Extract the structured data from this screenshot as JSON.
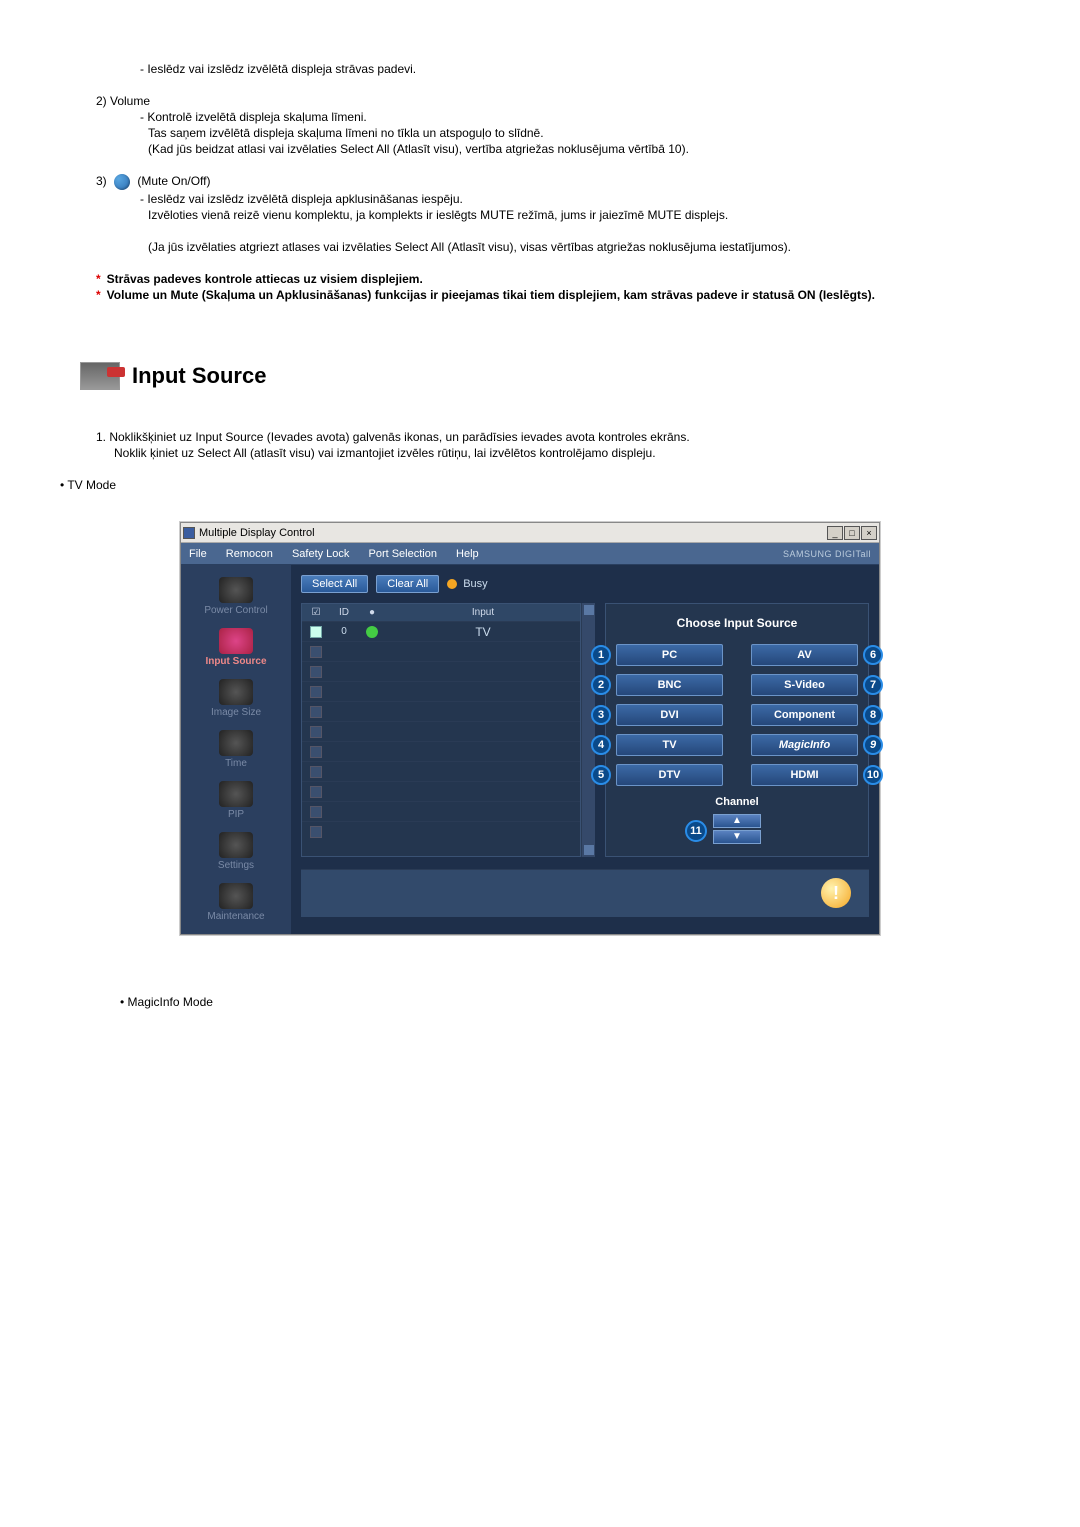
{
  "doc": {
    "item1_desc": "- Ieslēdz vai izslēdz izvēlētā displeja strāvas padevi.",
    "item2_title": "2)  Volume",
    "item2_line1": "- Kontrolē izvelētā displeja skaļuma līmeni.",
    "item2_line2": "Tas saņem izvēlētā displeja skaļuma līmeni no tīkla un atspoguļo to slīdnē.",
    "item2_line3": "(Kad jūs beidzat atlasi vai izvēlaties Select All (Atlasīt visu), vertība atgriežas noklusējuma vērtībā 10).",
    "item3_prefix": "3)",
    "item3_suffix": "(Mute On/Off)",
    "item3_line1": "- Ieslēdz vai izslēdz izvēlētā displeja apklusināšanas iespēju.",
    "item3_line2": "Izvēloties vienā reizē vienu komplektu, ja komplekts ir ieslēgts MUTE režīmā, jums ir jaiezīmē MUTE displejs.",
    "item3_line3": "(Ja jūs izvēlaties atgriezt atlases vai izvēlaties Select All (Atlasīt visu), visas vērtības atgriežas noklusējuma iestatījumos).",
    "note1": "Strāvas padeves kontrole attiecas uz visiem displejiem.",
    "note2": "Volume un Mute (Skaļuma un Apklusināšanas) funkcijas ir pieejamas tikai tiem displejiem, kam strāvas padeve ir statusā ON (Ieslēgts).",
    "section_title": "Input Source",
    "step1_a": "1.  Noklikšķiniet uz Input Source (Ievades avota) galvenās ikonas, un parādīsies ievades avota kontroles ekrāns.",
    "step1_b": "Noklik    ķiniet uz Select All (atlasīt visu) vai izmantojiet izvēles rūtiņu, lai izvēlētos kontrolējamo displeju.",
    "tv_mode": "• TV Mode",
    "magic_mode": "• MagicInfo Mode"
  },
  "app": {
    "title": "Multiple Display Control",
    "menus": {
      "file": "File",
      "remocon": "Remocon",
      "safety": "Safety Lock",
      "port": "Port Selection",
      "help": "Help"
    },
    "brand": "SAMSUNG DIGITall",
    "sidebar": {
      "power": "Power Control",
      "input": "Input Source",
      "image": "Image Size",
      "time": "Time",
      "pip": "PIP",
      "settings": "Settings",
      "maint": "Maintenance"
    },
    "toolbar": {
      "select_all": "Select All",
      "clear_all": "Clear All",
      "busy": "Busy"
    },
    "table": {
      "h1": "☑",
      "h2": "ID",
      "h3": "●",
      "h4": "Input",
      "row0_id": "0",
      "row0_input": "TV"
    },
    "panel": {
      "title": "Choose Input Source",
      "pc": "PC",
      "av": "AV",
      "bnc": "BNC",
      "svideo": "S-Video",
      "dvi": "DVI",
      "component": "Component",
      "tv": "TV",
      "magicinfo": "MagicInfo",
      "dtv": "DTV",
      "hdmi": "HDMI",
      "badge1": "1",
      "badge2": "2",
      "badge3": "3",
      "badge4": "4",
      "badge5": "5",
      "badge6": "6",
      "badge7": "7",
      "badge8": "8",
      "badge9": "9",
      "badge10": "10",
      "badge11": "11",
      "channel": "Channel"
    }
  }
}
